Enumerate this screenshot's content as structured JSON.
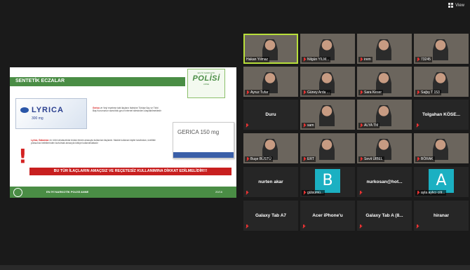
{
  "topbar": {
    "view_label": "View"
  },
  "slide": {
    "header": "SENTETİK ECZALAR",
    "logo": {
      "top": "EN İYİ NARKOTİK",
      "main": "POLİSİ",
      "sub": "ANNE"
    },
    "lyrica_name": "LYRICA",
    "lyrica_dose": "300 mg",
    "para1_lead": "Gerica",
    "para1": " ve Veyl reçetese tabi ilaçların listesine Türkiye İlaç ve Tıbbi Baş Kurumunun www.titck.gov.tr internet sitesinden ulaşılabilmektedir",
    "gerica_name": "GERICA 150 mg",
    "para2_lead": "Lyrica, Gabamax",
    "para2": " vb. tıbbi rahatsızlıklar tedavi etmek amacıyla kullanılan ilaçlardır. Madde kullanan kişiler tarafından, özellikle yoksunluk belirtilerinden kurtulmak amacıyla kötüye kullanılmaktadır",
    "warning": "BU TÜR İLAÇLARIN AMAÇSIZ VE REÇETESİZ KULLANIMINA DİKKAT EDİLMELİDİR!!!",
    "footer": "EN İYİ NARKOTİK POLİSİ ANNE",
    "page": "20/16"
  },
  "tiles": [
    {
      "label": "Hakan Yılmaz"
    },
    {
      "label": "Nilgün YILM..."
    },
    {
      "label": "irem"
    },
    {
      "label": "73245"
    },
    {
      "label": "Ayruz Tufar"
    },
    {
      "label": "Güney Arda ..."
    },
    {
      "label": "Sara Keser"
    },
    {
      "label": "Sağış T 153"
    },
    {
      "name": "Duru"
    },
    {
      "label": "sam"
    },
    {
      "label": "ALYA TM"
    },
    {
      "name": "Tolgahan KÖSE..."
    },
    {
      "label": "Buşe BÜSTÜ"
    },
    {
      "label": "ERT"
    },
    {
      "label": "Sevit ÜlBEL"
    },
    {
      "label": "BÖRAK"
    },
    {
      "name": "nurten akar"
    },
    {
      "label": "gülsümü..."
    },
    {
      "name": "nurkosan@hot..."
    },
    {
      "label": "ayla aylıcı cöt..."
    },
    {
      "name": "Galaxy Tab A7"
    },
    {
      "name": "Acer iPhone'u"
    },
    {
      "name": "Galaxy Tab A (8..."
    },
    {
      "name": "hiranar"
    }
  ],
  "avatars": {
    "tile18": "B",
    "tile20": "A"
  },
  "colors": {
    "active_border": "#b8df3a",
    "slide_green": "#4a8d45",
    "warning_red": "#c81f1f",
    "avatar_teal": "#1bb0c2"
  }
}
